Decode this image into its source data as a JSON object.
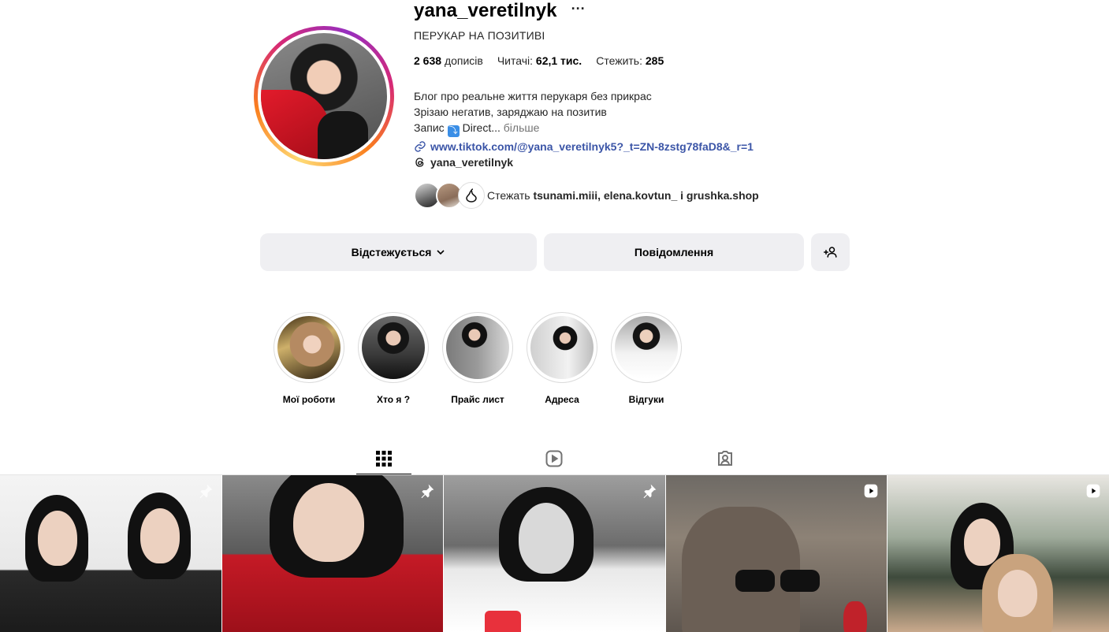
{
  "profile": {
    "username": "yana_veretilnyk",
    "category": "ПЕРУКАР НА ПОЗИТИВІ",
    "stats": {
      "posts_value": "2 638",
      "posts_label": "дописів",
      "followers_label": "Читачі:",
      "followers_value": "62,1 тис.",
      "following_label": "Стежить:",
      "following_value": "285"
    },
    "bio": {
      "line1": "Блог про реальне життя перукаря без прикрас",
      "line2": "Зрізаю негатив, заряджаю на позитив",
      "line3_start": "Запис",
      "line3_emoji": "⤵",
      "line3_end": "Direct...",
      "more": "більше"
    },
    "link": "www.tiktok.com/@yana_veretilnyk5?_t=ZN-8zstg78faD8&_r=1",
    "threads": "yana_veretilnyk",
    "followed_by": {
      "prefix": "Стежать",
      "names": "tsunami.miii, elena.kovtun_ і grushka.shop"
    }
  },
  "actions": {
    "following": "Відстежується",
    "message": "Повідомлення"
  },
  "highlights": [
    {
      "label": "Мої роботи"
    },
    {
      "label": "Хто я ?"
    },
    {
      "label": "Прайс лист"
    },
    {
      "label": "Адреса"
    },
    {
      "label": "Відгуки"
    }
  ],
  "tabs": [
    "grid-icon",
    "reels-icon",
    "tagged-icon"
  ],
  "colors": {
    "link": "#3b55a7",
    "button_bg": "#efeff2",
    "muted": "#737373"
  }
}
